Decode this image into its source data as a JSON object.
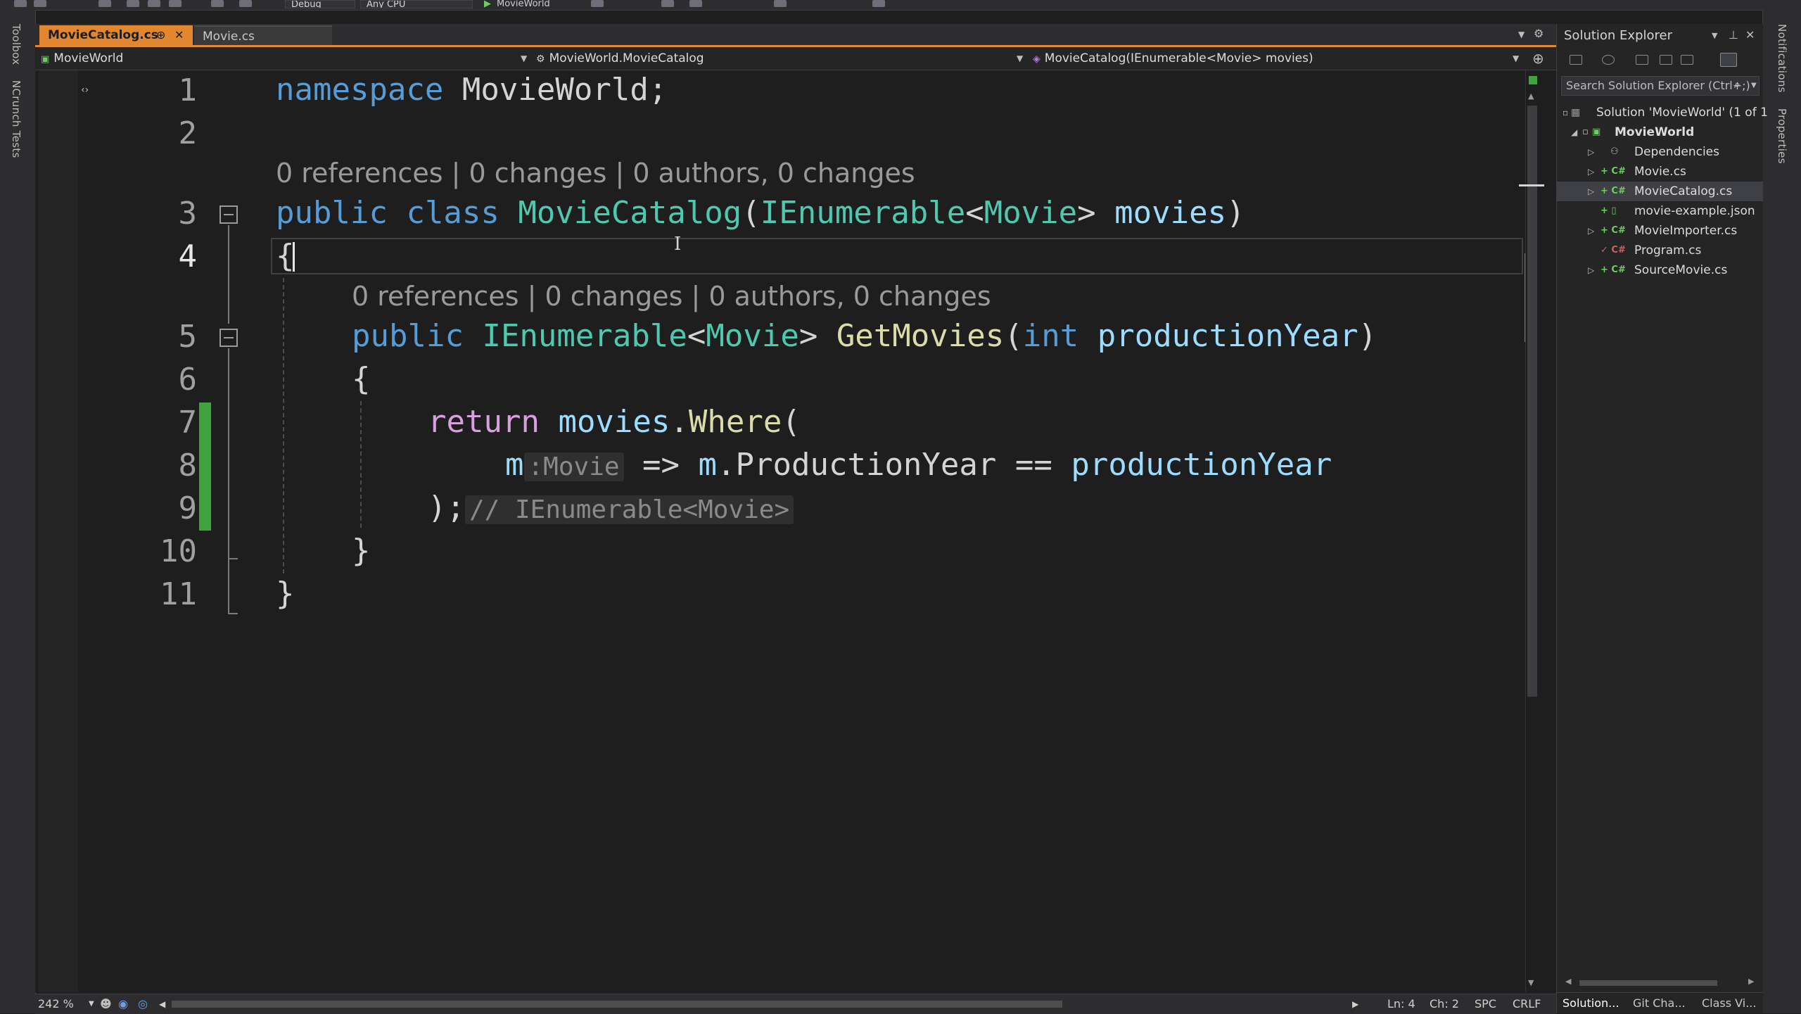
{
  "toolbar": {
    "config": "Debug",
    "platform": "Any CPU",
    "run_target": "MovieWorld"
  },
  "left_strip": {
    "toolbox": "Toolbox",
    "ncrunch": "NCrunch Tests"
  },
  "right_strip": {
    "notifications": "Notifications",
    "properties": "Properties"
  },
  "tabs": [
    {
      "label": "MovieCatalog.cs",
      "active": true
    },
    {
      "label": "Movie.cs",
      "active": false
    }
  ],
  "nav": {
    "project": "MovieWorld",
    "type": "MovieWorld.MovieCatalog",
    "member": "MovieCatalog(IEnumerable<Movie> movies)"
  },
  "editor": {
    "line_numbers": [
      "1",
      "2",
      "3",
      "4",
      "5",
      "6",
      "7",
      "8",
      "9",
      "10",
      "11"
    ],
    "code_lens": "0 references | 0 changes | 0 authors, 0 changes",
    "line1": {
      "kw": "namespace",
      "name": "MovieWorld;"
    },
    "line3": {
      "kw1": "public",
      "kw2": "class",
      "type": "MovieCatalog",
      "paren": "(",
      "type2": "IEnumerable",
      "lt": "<",
      "type3": "Movie",
      "gt": ">",
      "param": "movies",
      "close": ")"
    },
    "line4": "{",
    "line5": {
      "kw": "public",
      "type": "IEnumerable",
      "lt": "<",
      "type2": "Movie",
      "gt": ">",
      "fn": "GetMovies",
      "paren": "(",
      "kw2": "int",
      "param": "productionYear",
      "close": ")"
    },
    "line6": "{",
    "line7": {
      "kw": "return",
      "id": "movies",
      "dot": ".",
      "fn": "Where",
      "paren": "("
    },
    "line8": {
      "m": "m",
      "hint": ":Movie",
      "arrow": "=>",
      "m2": "m",
      "prop": ".ProductionYear",
      "op": "==",
      "param": "productionYear"
    },
    "line9": {
      "close": ");",
      "hint": "// IEnumerable<Movie>"
    },
    "line10": "}",
    "line11": "}"
  },
  "status": {
    "zoom": "242 %",
    "ln": "Ln: 4",
    "ch": "Ch: 2",
    "spc": "SPC",
    "crlf": "CRLF"
  },
  "solution_explorer": {
    "title": "Solution Explorer",
    "search_placeholder": "Search Solution Explorer (Ctrl+;)",
    "tree": [
      {
        "label": "Solution 'MovieWorld' (1 of 1",
        "level": 0,
        "bold": false
      },
      {
        "label": "MovieWorld",
        "level": 1,
        "bold": true
      },
      {
        "label": "Dependencies",
        "level": 2,
        "bold": false
      },
      {
        "label": "Movie.cs",
        "level": 2,
        "bold": false
      },
      {
        "label": "MovieCatalog.cs",
        "level": 2,
        "bold": false,
        "selected": true
      },
      {
        "label": "movie-example.json",
        "level": 2,
        "bold": false
      },
      {
        "label": "MovieImporter.cs",
        "level": 2,
        "bold": false
      },
      {
        "label": "Program.cs",
        "level": 2,
        "bold": false
      },
      {
        "label": "SourceMovie.cs",
        "level": 2,
        "bold": false
      }
    ],
    "bottom_tabs": [
      "Solution...",
      "Git Cha...",
      "Class Vi..."
    ]
  },
  "colors": {
    "accent_tab": "#e0872f",
    "keyword": "#569cd6",
    "type": "#4ec9b0",
    "method": "#dcdcaa",
    "identifier": "#9cdcfe",
    "control_keyword": "#d8a0df",
    "change_bar": "#3fa43f"
  },
  "icons": [
    "csharp-file-icon",
    "json-file-icon",
    "dependencies-icon",
    "solution-icon",
    "project-icon",
    "search-icon",
    "close-icon",
    "pin-icon",
    "settings-icon",
    "run-icon"
  ]
}
